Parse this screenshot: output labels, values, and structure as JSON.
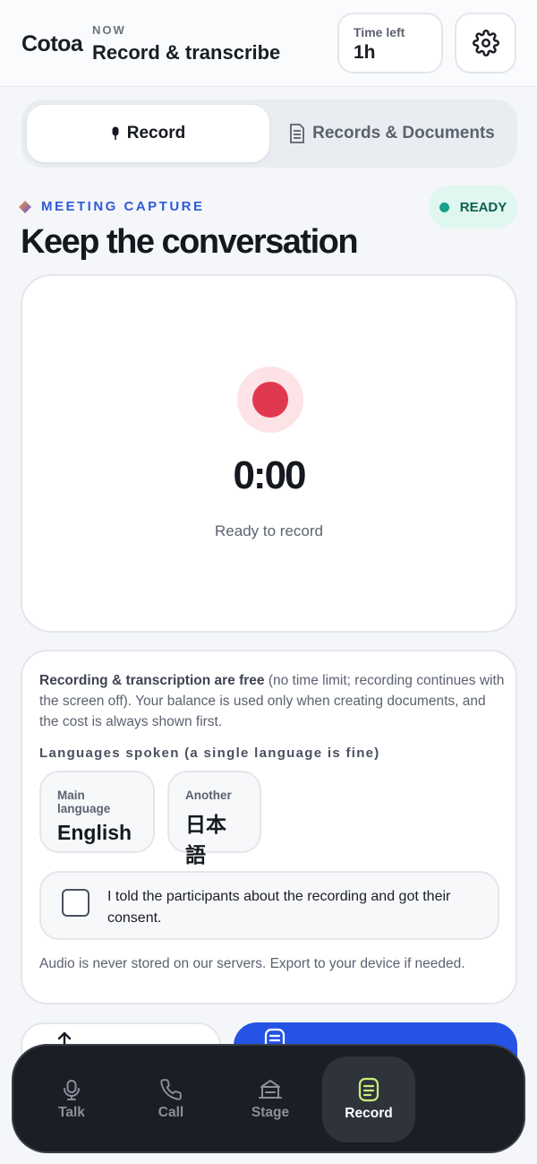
{
  "header": {
    "brand": "Cotoa",
    "now_label": "NOW",
    "title": "Record & transcribe",
    "time_left_label": "Time left",
    "time_left_value": "1h"
  },
  "tabs": [
    {
      "label": "Record",
      "active": true
    },
    {
      "label": "Records & Documents",
      "active": false
    }
  ],
  "section": {
    "eyebrow": "MEETING CAPTURE",
    "status": "READY",
    "title": "Keep the conversation"
  },
  "recorder": {
    "timer": "0:00",
    "status": "Ready to record"
  },
  "info": {
    "free_bold": "Recording & transcription are free",
    "free_rest": " (no time limit; recording continues with the screen off). Your balance is used only when creating documents, and the cost is always shown first.",
    "languages_heading": "Languages spoken (a single language is fine)",
    "languages": [
      {
        "label": "Main language",
        "value": "English"
      },
      {
        "label": "Another",
        "value": "日本語"
      }
    ],
    "consent_text": "I told the participants about the recording and got their consent.",
    "consent_checked": false,
    "privacy_note": "Audio is never stored on our servers. Export to your device if needed."
  },
  "nav": [
    {
      "label": "Talk",
      "icon": "mic-icon",
      "active": false
    },
    {
      "label": "Call",
      "icon": "phone-icon",
      "active": false
    },
    {
      "label": "Stage",
      "icon": "stage-icon",
      "active": false
    },
    {
      "label": "Record",
      "icon": "document-icon",
      "active": true
    }
  ],
  "colors": {
    "accent": "#2453e6",
    "record": "#e0394f",
    "ready_bg": "#dff7ef",
    "ready_dot": "#14a38a",
    "nav_active_icon": "#c6f07a"
  }
}
